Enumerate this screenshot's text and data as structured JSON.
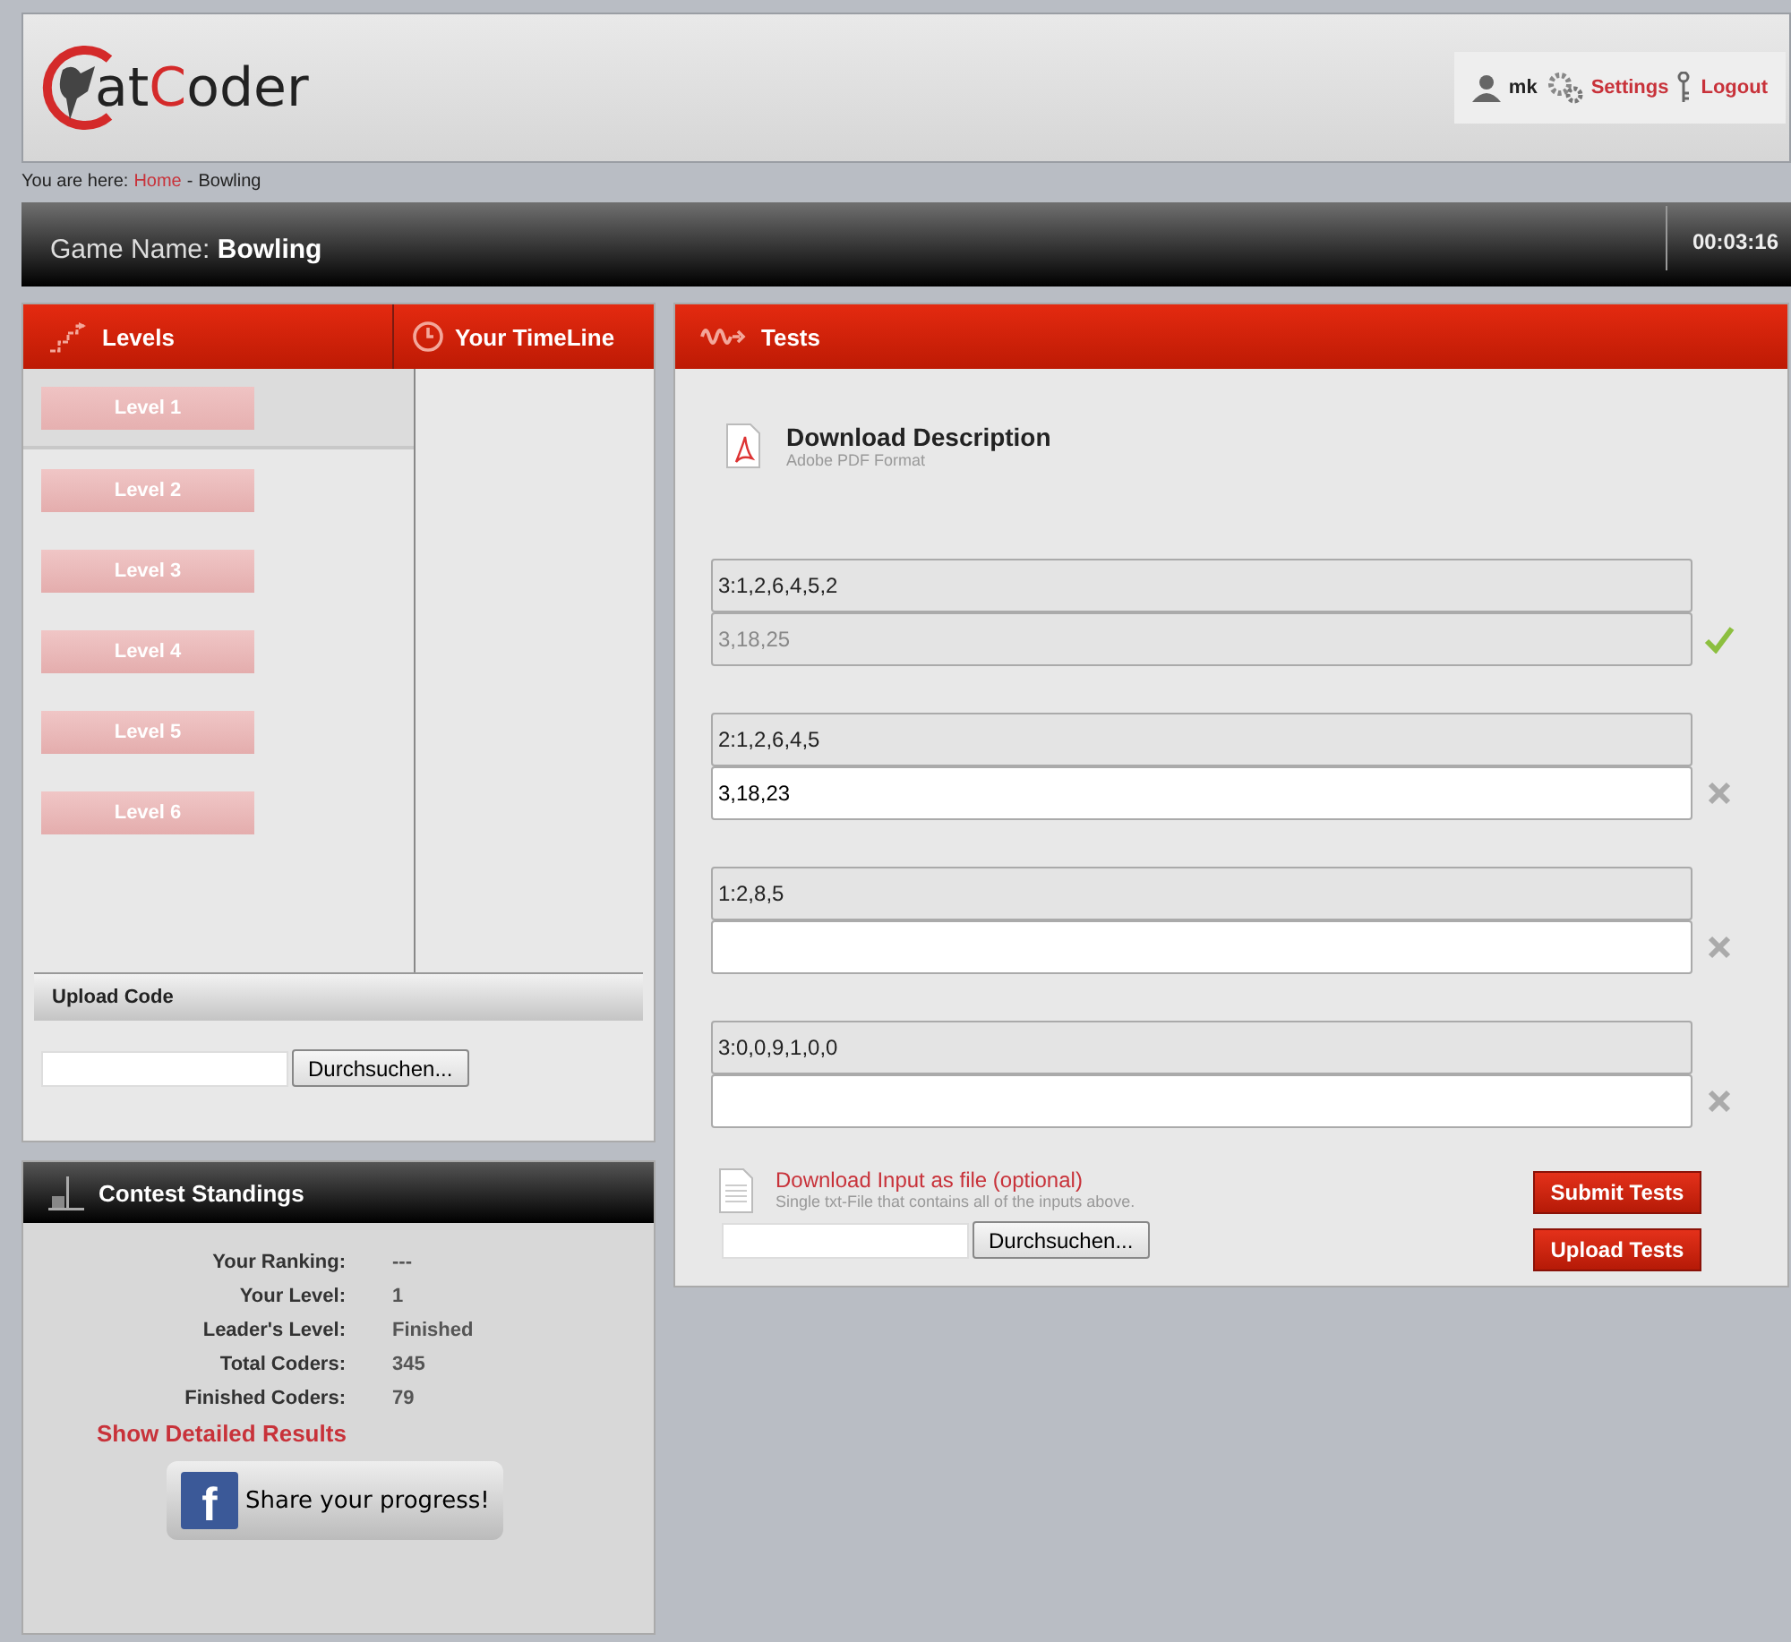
{
  "header": {
    "logo": [
      {
        "text": "at",
        "accent": false
      },
      {
        "text": "C",
        "accent": true
      },
      {
        "text": "oder",
        "accent": false
      }
    ],
    "user": {
      "name": "mk",
      "settings": "Settings",
      "logout": "Logout"
    }
  },
  "breadcrumb": {
    "prefix": "You are here:",
    "link": "Home",
    "separator": "-",
    "current": "Bowling"
  },
  "game_bar": {
    "label": "Game Name:",
    "name": "Bowling",
    "timer": "00:03:16"
  },
  "levels_panel": {
    "title": "Levels",
    "timeline_title": "Your TimeLine",
    "levels": [
      {
        "label": "Level 1",
        "selected": true
      },
      {
        "label": "Level 2",
        "selected": false
      },
      {
        "label": "Level 3",
        "selected": false
      },
      {
        "label": "Level 4",
        "selected": false
      },
      {
        "label": "Level 5",
        "selected": false
      },
      {
        "label": "Level 6",
        "selected": false
      }
    ],
    "upload_title": "Upload Code",
    "browse_button": "Durchsuchen..."
  },
  "standings": {
    "title": "Contest Standings",
    "rows": [
      {
        "label": "Your Ranking:",
        "value": "---"
      },
      {
        "label": "Your Level:",
        "value": "1"
      },
      {
        "label": "Leader's Level:",
        "value": "Finished"
      },
      {
        "label": "Total Coders:",
        "value": "345"
      },
      {
        "label": "Finished Coders:",
        "value": "79"
      }
    ],
    "details_link": "Show Detailed Results",
    "share": {
      "icon_letter": "f",
      "text": "Share your progress!"
    }
  },
  "tests_panel": {
    "title": "Tests",
    "download": {
      "title": "Download Description",
      "subtitle": "Adobe PDF Format"
    },
    "tests": [
      {
        "input": "3:1,2,6,4,5,2",
        "output": "3,18,25",
        "disabled": true,
        "passed": true
      },
      {
        "input": "2:1,2,6,4,5",
        "output": "3,18,23",
        "disabled": false,
        "passed": false
      },
      {
        "input": "1:2,8,5",
        "disabled": false,
        "passed": false
      },
      {
        "input": "3:0,0,9,1,0,0",
        "disabled": false,
        "passed": false
      }
    ],
    "input_file": {
      "title": "Download Input as file (optional)",
      "subtitle": "Single txt-File that contains all of the inputs above.",
      "browse_button": "Durchsuchen..."
    },
    "buttons": [
      "Submit Tests",
      "Upload Tests"
    ]
  }
}
